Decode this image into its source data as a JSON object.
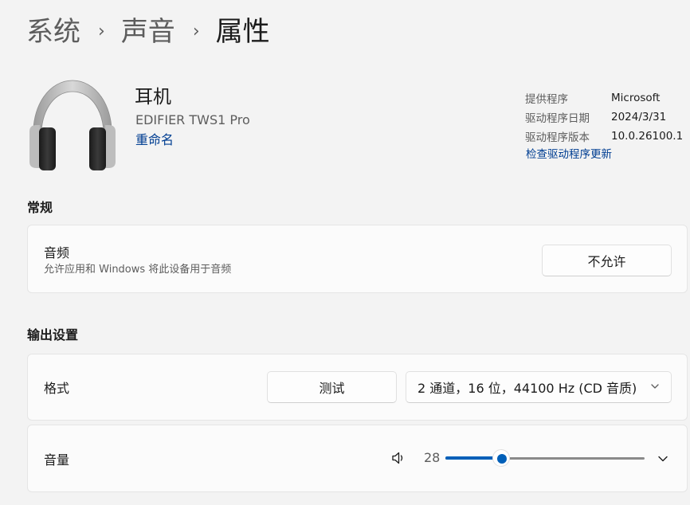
{
  "breadcrumb": {
    "items": [
      "系统",
      "声音"
    ],
    "separator": "›",
    "current": "属性"
  },
  "device": {
    "name": "耳机",
    "model": "EDIFIER TWS1 Pro",
    "rename_label": "重命名",
    "icon": "headphones-icon"
  },
  "driver": {
    "provider_label": "提供程序",
    "provider_value": "Microsoft",
    "date_label": "驱动程序日期",
    "date_value": "2024/3/31",
    "version_label": "驱动程序版本",
    "version_value": "10.0.26100.1",
    "update_link": "检查驱动程序更新"
  },
  "general": {
    "section_title": "常规",
    "audio_title": "音频",
    "audio_desc": "允许应用和 Windows 将此设备用于音频",
    "audio_button": "不允许"
  },
  "output": {
    "section_title": "输出设置",
    "format_label": "格式",
    "test_button": "测试",
    "format_value": "2 通道，16 位，44100 Hz (CD 音质)",
    "volume_label": "音量",
    "volume_value": "28",
    "volume_level": 0.28,
    "speaker_icon": "speaker-icon",
    "expand_icon": "chevron-down-icon"
  },
  "colors": {
    "accent": "#005fb8",
    "link": "#003e92",
    "background": "#f3f3f3",
    "card": "#fbfbfb"
  }
}
